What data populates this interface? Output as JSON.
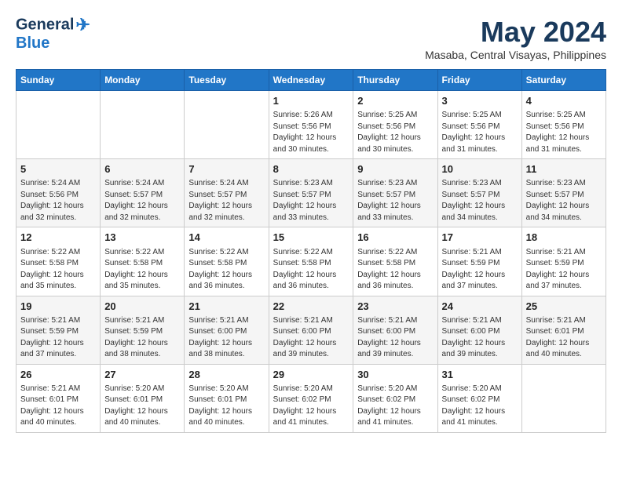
{
  "header": {
    "logo_line1": "General",
    "logo_line2": "Blue",
    "title": "May 2024",
    "subtitle": "Masaba, Central Visayas, Philippines"
  },
  "days_of_week": [
    "Sunday",
    "Monday",
    "Tuesday",
    "Wednesday",
    "Thursday",
    "Friday",
    "Saturday"
  ],
  "weeks": [
    [
      {
        "num": "",
        "info": ""
      },
      {
        "num": "",
        "info": ""
      },
      {
        "num": "",
        "info": ""
      },
      {
        "num": "1",
        "info": "Sunrise: 5:26 AM\nSunset: 5:56 PM\nDaylight: 12 hours\nand 30 minutes."
      },
      {
        "num": "2",
        "info": "Sunrise: 5:25 AM\nSunset: 5:56 PM\nDaylight: 12 hours\nand 30 minutes."
      },
      {
        "num": "3",
        "info": "Sunrise: 5:25 AM\nSunset: 5:56 PM\nDaylight: 12 hours\nand 31 minutes."
      },
      {
        "num": "4",
        "info": "Sunrise: 5:25 AM\nSunset: 5:56 PM\nDaylight: 12 hours\nand 31 minutes."
      }
    ],
    [
      {
        "num": "5",
        "info": "Sunrise: 5:24 AM\nSunset: 5:56 PM\nDaylight: 12 hours\nand 32 minutes."
      },
      {
        "num": "6",
        "info": "Sunrise: 5:24 AM\nSunset: 5:57 PM\nDaylight: 12 hours\nand 32 minutes."
      },
      {
        "num": "7",
        "info": "Sunrise: 5:24 AM\nSunset: 5:57 PM\nDaylight: 12 hours\nand 32 minutes."
      },
      {
        "num": "8",
        "info": "Sunrise: 5:23 AM\nSunset: 5:57 PM\nDaylight: 12 hours\nand 33 minutes."
      },
      {
        "num": "9",
        "info": "Sunrise: 5:23 AM\nSunset: 5:57 PM\nDaylight: 12 hours\nand 33 minutes."
      },
      {
        "num": "10",
        "info": "Sunrise: 5:23 AM\nSunset: 5:57 PM\nDaylight: 12 hours\nand 34 minutes."
      },
      {
        "num": "11",
        "info": "Sunrise: 5:23 AM\nSunset: 5:57 PM\nDaylight: 12 hours\nand 34 minutes."
      }
    ],
    [
      {
        "num": "12",
        "info": "Sunrise: 5:22 AM\nSunset: 5:58 PM\nDaylight: 12 hours\nand 35 minutes."
      },
      {
        "num": "13",
        "info": "Sunrise: 5:22 AM\nSunset: 5:58 PM\nDaylight: 12 hours\nand 35 minutes."
      },
      {
        "num": "14",
        "info": "Sunrise: 5:22 AM\nSunset: 5:58 PM\nDaylight: 12 hours\nand 36 minutes."
      },
      {
        "num": "15",
        "info": "Sunrise: 5:22 AM\nSunset: 5:58 PM\nDaylight: 12 hours\nand 36 minutes."
      },
      {
        "num": "16",
        "info": "Sunrise: 5:22 AM\nSunset: 5:58 PM\nDaylight: 12 hours\nand 36 minutes."
      },
      {
        "num": "17",
        "info": "Sunrise: 5:21 AM\nSunset: 5:59 PM\nDaylight: 12 hours\nand 37 minutes."
      },
      {
        "num": "18",
        "info": "Sunrise: 5:21 AM\nSunset: 5:59 PM\nDaylight: 12 hours\nand 37 minutes."
      }
    ],
    [
      {
        "num": "19",
        "info": "Sunrise: 5:21 AM\nSunset: 5:59 PM\nDaylight: 12 hours\nand 37 minutes."
      },
      {
        "num": "20",
        "info": "Sunrise: 5:21 AM\nSunset: 5:59 PM\nDaylight: 12 hours\nand 38 minutes."
      },
      {
        "num": "21",
        "info": "Sunrise: 5:21 AM\nSunset: 6:00 PM\nDaylight: 12 hours\nand 38 minutes."
      },
      {
        "num": "22",
        "info": "Sunrise: 5:21 AM\nSunset: 6:00 PM\nDaylight: 12 hours\nand 39 minutes."
      },
      {
        "num": "23",
        "info": "Sunrise: 5:21 AM\nSunset: 6:00 PM\nDaylight: 12 hours\nand 39 minutes."
      },
      {
        "num": "24",
        "info": "Sunrise: 5:21 AM\nSunset: 6:00 PM\nDaylight: 12 hours\nand 39 minutes."
      },
      {
        "num": "25",
        "info": "Sunrise: 5:21 AM\nSunset: 6:01 PM\nDaylight: 12 hours\nand 40 minutes."
      }
    ],
    [
      {
        "num": "26",
        "info": "Sunrise: 5:21 AM\nSunset: 6:01 PM\nDaylight: 12 hours\nand 40 minutes."
      },
      {
        "num": "27",
        "info": "Sunrise: 5:20 AM\nSunset: 6:01 PM\nDaylight: 12 hours\nand 40 minutes."
      },
      {
        "num": "28",
        "info": "Sunrise: 5:20 AM\nSunset: 6:01 PM\nDaylight: 12 hours\nand 40 minutes."
      },
      {
        "num": "29",
        "info": "Sunrise: 5:20 AM\nSunset: 6:02 PM\nDaylight: 12 hours\nand 41 minutes."
      },
      {
        "num": "30",
        "info": "Sunrise: 5:20 AM\nSunset: 6:02 PM\nDaylight: 12 hours\nand 41 minutes."
      },
      {
        "num": "31",
        "info": "Sunrise: 5:20 AM\nSunset: 6:02 PM\nDaylight: 12 hours\nand 41 minutes."
      },
      {
        "num": "",
        "info": ""
      }
    ]
  ]
}
